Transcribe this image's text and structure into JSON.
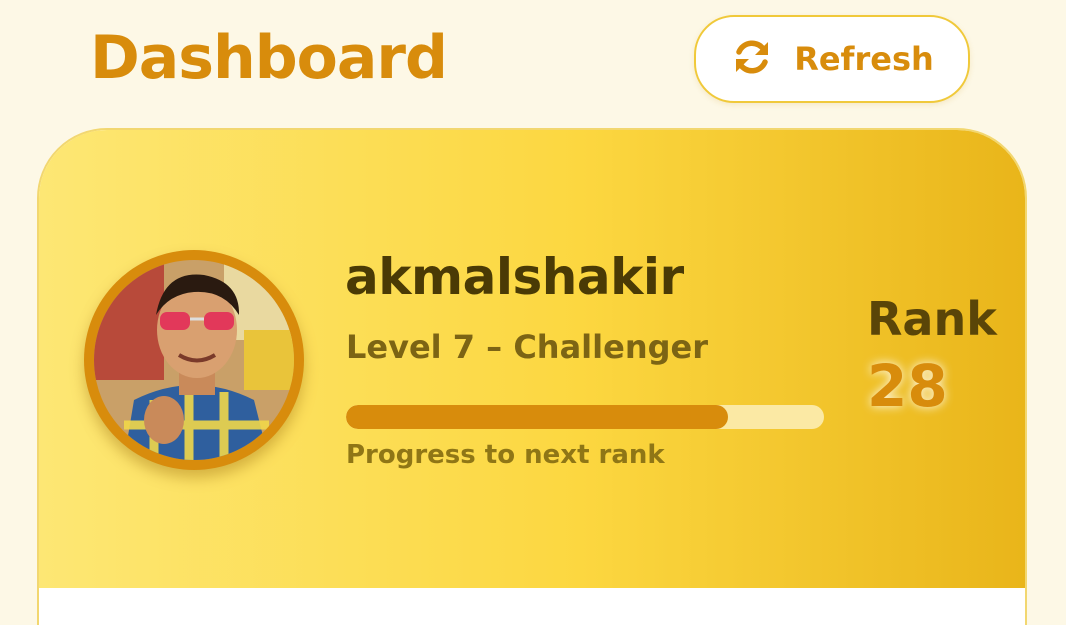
{
  "header": {
    "title": "Dashboard",
    "refresh_label": "Refresh",
    "refresh_icon": "refresh-icon"
  },
  "profile": {
    "username": "akmalshakir",
    "level_text": "Level 7 – Challenger",
    "progress_label": "Progress to next rank",
    "progress_fraction": 0.8,
    "avatar_icon": "user-avatar"
  },
  "rank": {
    "label": "Rank",
    "value": "28"
  },
  "colors": {
    "accent": "#d88c0c",
    "banner_start": "#fde774",
    "banner_end": "#e9b51a",
    "text_dark": "#4a3a05",
    "background": "#fdf8e6"
  }
}
